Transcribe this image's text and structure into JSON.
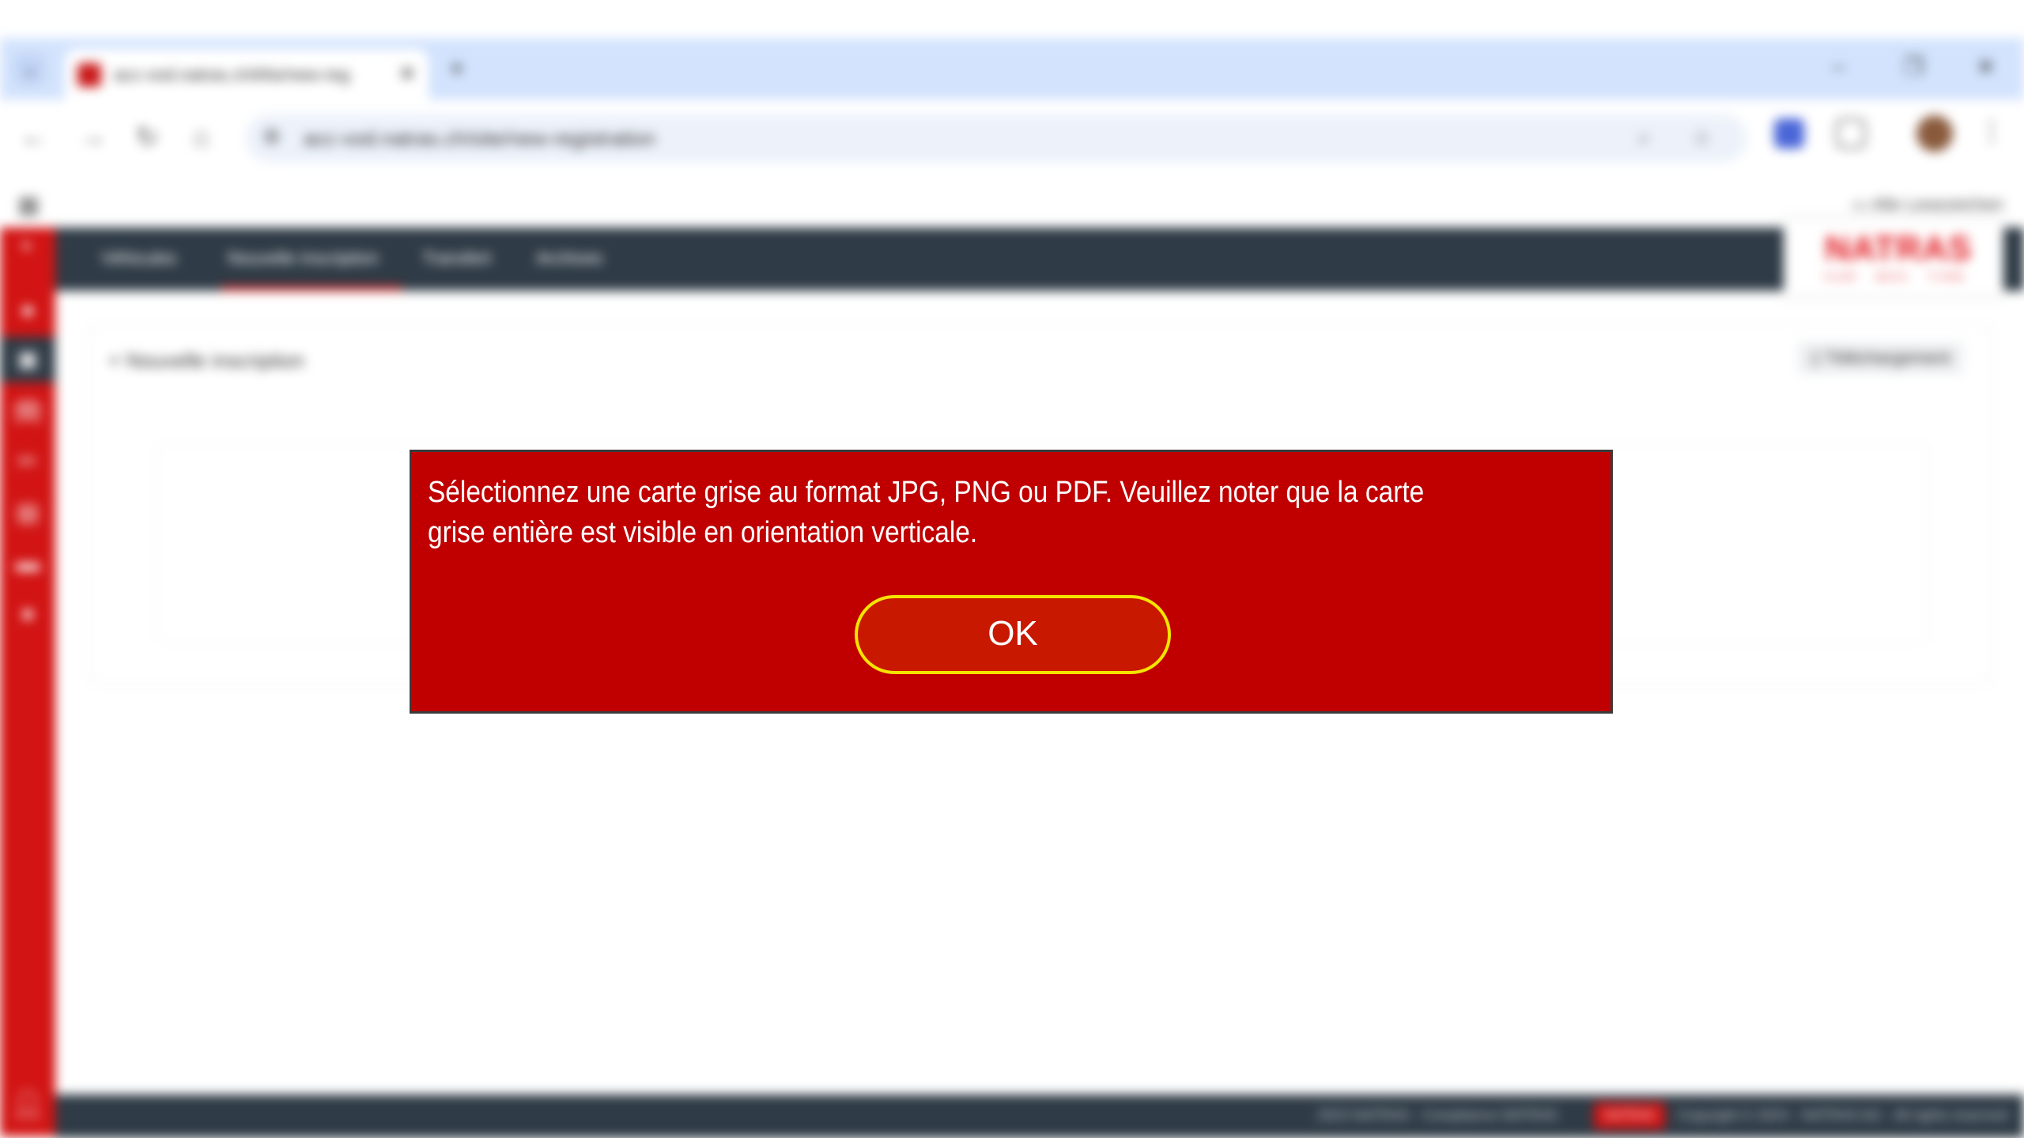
{
  "browser": {
    "tab_title": "acc-vod.natras.ch/kfw/new-reg",
    "tab_close": "✕",
    "new_tab": "+",
    "window_controls": [
      "–",
      "❐",
      "✕"
    ],
    "url": "acc-vod.natras.ch/site/new-registration",
    "bookmark_folder": "Alle Lesezeichen"
  },
  "app": {
    "brand_name": "NATRAS",
    "brand_sub": "CAR · BOX · TIRE",
    "nav": [
      "Véhicules",
      "Nouvelle inscription",
      "Transfert",
      "Archives"
    ],
    "page_title": "Nouvelle inscription",
    "card_action": "Téléchargement",
    "footer_left": "2023 NATRAS · Compliance NATRAS",
    "footer_badge": "NATRAS",
    "footer_right": "Copyright © 2024 · NATRAS AG · All rights reserved"
  },
  "dialog": {
    "message": "Sélectionnez une carte grise au format JPG, PNG ou PDF. Veuillez noter que la carte grise entière est visible en orientation verticale.",
    "ok_label": "OK"
  },
  "colors": {
    "dialog_bg": "#c00000",
    "ok_button_bg": "#c81800",
    "ok_button_border": "#f4e400",
    "sidebar": "#d21414",
    "nav_bar": "#2f3b46"
  }
}
